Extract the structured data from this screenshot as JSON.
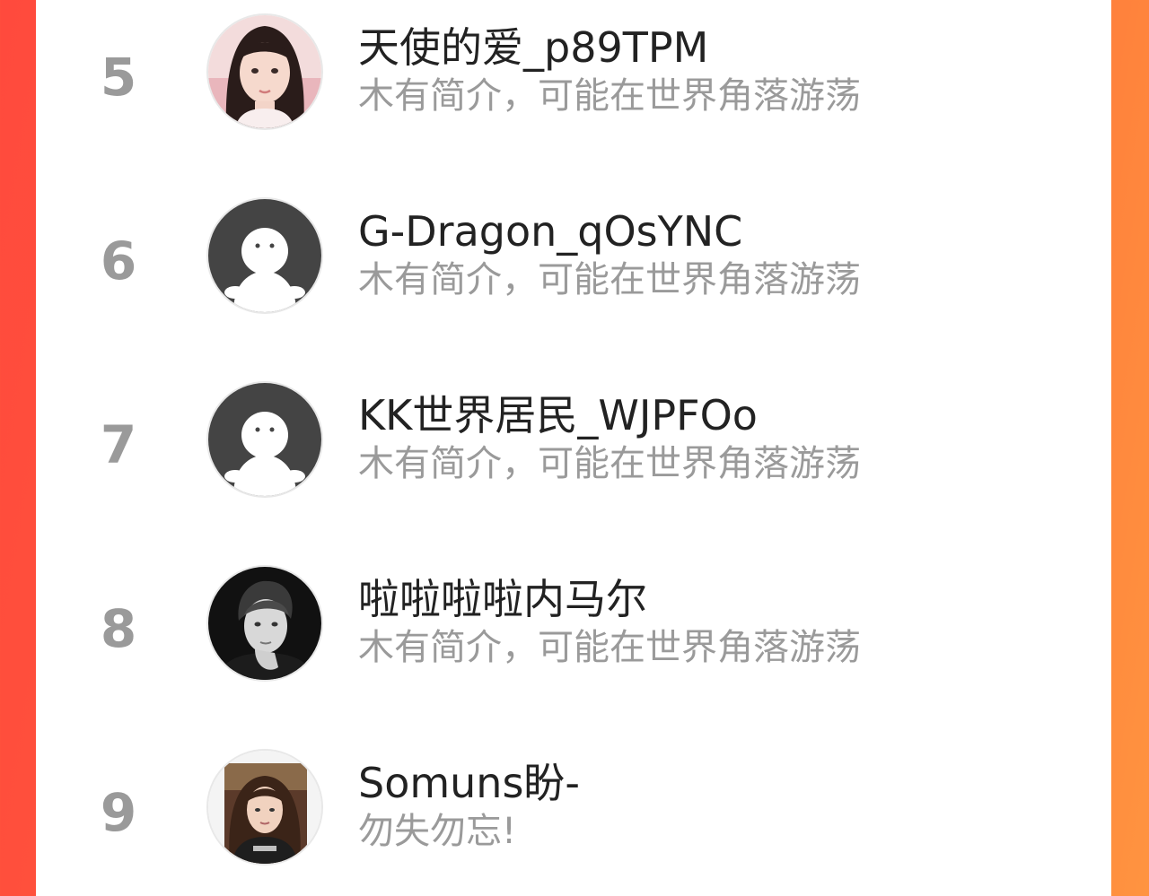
{
  "leaderboard": {
    "items": [
      {
        "rank": "5",
        "name": "天使的爱_p89TPM",
        "bio": "木有简介，可能在世界角落游荡",
        "avatar": "photo-avatar-girl"
      },
      {
        "rank": "6",
        "name": "G-Dragon_qOsYNC",
        "bio": "木有简介，可能在世界角落游荡",
        "avatar": "default-avatar"
      },
      {
        "rank": "7",
        "name": "KK世界居民_WJPFOo",
        "bio": "木有简介，可能在世界角落游荡",
        "avatar": "default-avatar"
      },
      {
        "rank": "8",
        "name": "啦啦啦啦内马尔",
        "bio": "木有简介，可能在世界角落游荡",
        "avatar": "photo-avatar-man-bw"
      },
      {
        "rank": "9",
        "name": "Somuns盼-",
        "bio": "勿失勿忘!",
        "avatar": "photo-avatar-woman"
      }
    ]
  },
  "colors": {
    "background_left": "#ff4a3d",
    "background_right": "#ff9440",
    "rank": "#9a9a9a",
    "name": "#222222",
    "bio": "#9a9a9a",
    "default_avatar_bg": "#444444"
  }
}
